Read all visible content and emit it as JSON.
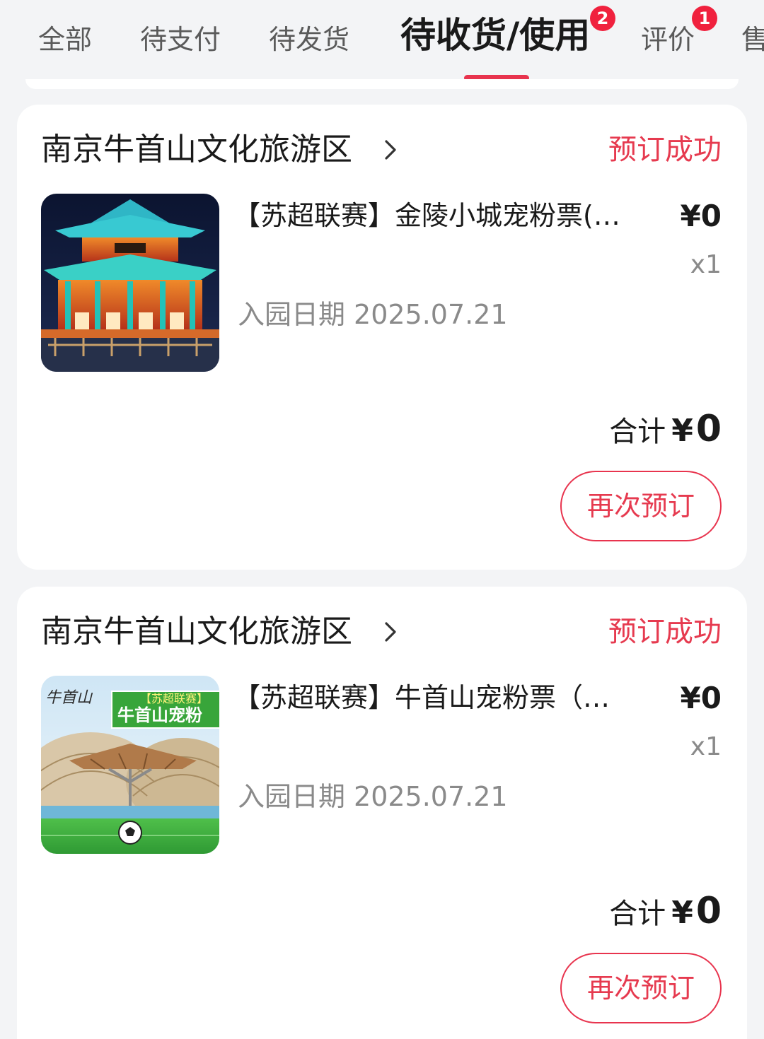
{
  "tabs": [
    {
      "label": "全部",
      "active": false
    },
    {
      "label": "待支付",
      "active": false
    },
    {
      "label": "待发货",
      "active": false
    },
    {
      "label": "待收货/使用",
      "active": true,
      "badge": "2"
    },
    {
      "label": "评价",
      "active": false,
      "badge": "1"
    },
    {
      "label": "售",
      "active": false
    }
  ],
  "colors": {
    "accent": "#e8344e",
    "badge": "#f0213e",
    "background": "#f3f4f6"
  },
  "orders": [
    {
      "shop_name": "南京牛首山文化旅游区",
      "status": "预订成功",
      "thumbnail_icon": "temple-night-photo",
      "product_title": "【苏超联赛】金陵小城宠粉票(…",
      "price": "¥0",
      "quantity": "x1",
      "visit_label": "入园日期",
      "visit_date": "2025.07.21",
      "total_label": "合计",
      "total_currency": "¥",
      "total_value": "0",
      "rebook_label": "再次预订"
    },
    {
      "shop_name": "南京牛首山文化旅游区",
      "status": "预订成功",
      "thumbnail_icon": "football-stadium-poster",
      "thumbnail_text": {
        "logo": "牛首山",
        "tag": "【苏超联赛】",
        "title": "牛首山宠粉"
      },
      "product_title": "【苏超联赛】牛首山宠粉票（…",
      "price": "¥0",
      "quantity": "x1",
      "visit_label": "入园日期",
      "visit_date": "2025.07.21",
      "total_label": "合计",
      "total_currency": "¥",
      "total_value": "0",
      "rebook_label": "再次预订"
    }
  ]
}
